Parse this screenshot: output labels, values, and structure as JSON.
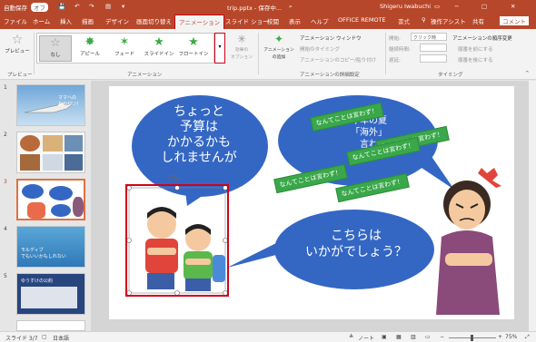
{
  "titlebar": {
    "autosave": "自動保存",
    "autosave_state": "オフ",
    "filename": "trip.pptx - 保存中...",
    "user": "Shigeru Iwabuchi"
  },
  "tabs": [
    "ファイル",
    "ホーム",
    "挿入",
    "描画",
    "デザイン",
    "画面切り替え",
    "アニメーション",
    "スライド ショー",
    "校閲",
    "表示",
    "ヘルプ",
    "OFFICE REMOTE",
    "書式"
  ],
  "active_tab": "アニメーション",
  "tell_me": "操作アシスト",
  "share": "共有",
  "comment": "コメント",
  "ribbon": {
    "preview_label": "プレビュー",
    "preview_group": "プレビュー",
    "animations_group": "アニメーション",
    "gallery": [
      "なし",
      "アピール",
      "フェード",
      "スライドイン",
      "フロートイン"
    ],
    "effect_options": "効果の\nオプション",
    "add_animation": "アニメーション\nの追加",
    "anim_pane": "アニメーション ウィンドウ",
    "trigger": "開始のタイミング",
    "painter": "アニメーションのコピー/貼り付け",
    "advanced_group": "アニメーションの詳細設定",
    "start_label": "開始:",
    "start_value": "クリック時",
    "duration_label": "継続時間:",
    "delay_label": "遅延:",
    "reorder": "アニメーションの順序変更",
    "earlier": "順番を前にする",
    "later": "順番を後にする",
    "timing_group": "タイミング"
  },
  "slides": [
    {
      "num": "1",
      "caption": "ママへの\nおねがい！"
    },
    {
      "num": "2",
      "caption": ""
    },
    {
      "num": "3",
      "caption": ""
    },
    {
      "num": "4",
      "caption": "モルディブ\nでもいいかもしれない"
    },
    {
      "num": "5",
      "caption": "ゆうすけの公約"
    }
  ],
  "current_slide": "3",
  "slide": {
    "bubble1": [
      "ちょっと",
      "予算は",
      "かかるかも",
      "しれませんが"
    ],
    "bubble2": [
      "こちらは",
      "いかがでしょう？"
    ],
    "bubble3": [
      "今年の夏",
      "「海外」",
      "言わ",
      "けど？"
    ],
    "labels": [
      "なんてことは言わず！",
      "なんてことは言わず！",
      "なんてことは言わず！",
      "なんてことは言わず！",
      "なんてことは言わず！"
    ]
  },
  "status": {
    "slide_num": "スライド 3/7",
    "language": "日本語",
    "notes": "ノート",
    "zoom": "75%"
  },
  "colors": {
    "accent": "#b7472a",
    "highlight": "#d0021b",
    "bubble": "#3467c4",
    "label_green": "#3aa84a"
  }
}
